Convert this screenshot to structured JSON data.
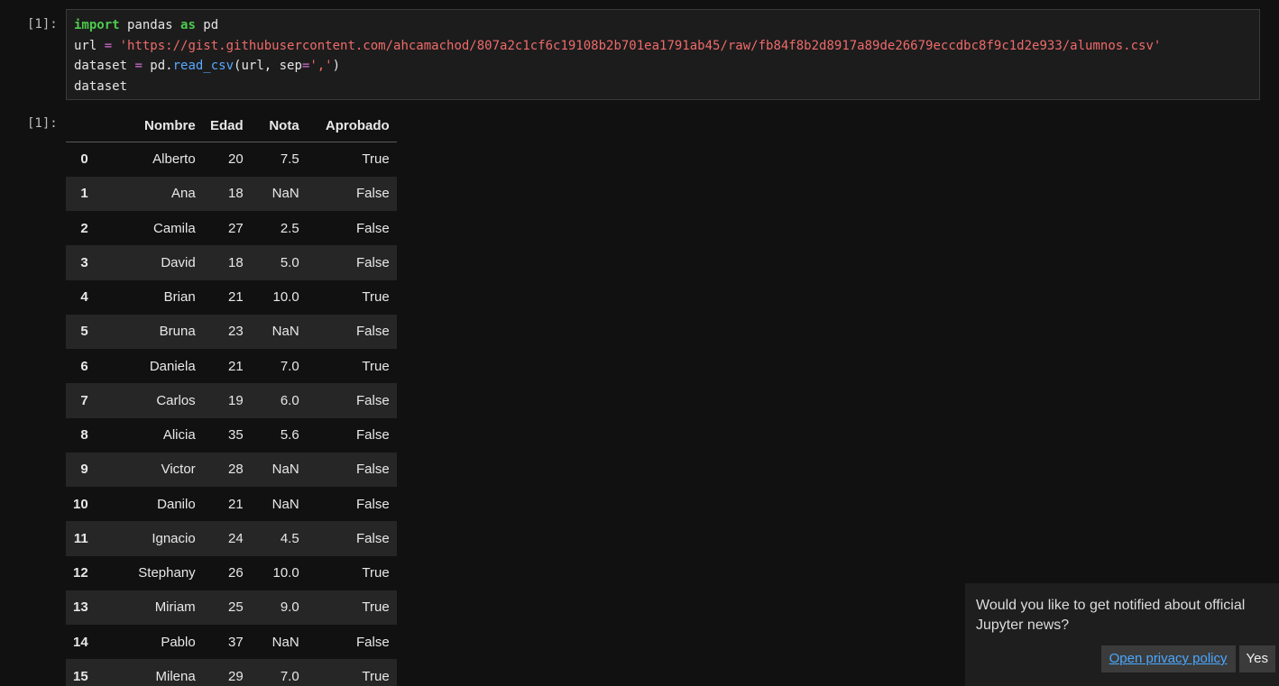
{
  "cells": [
    {
      "prompt": "[1]:",
      "code": {
        "line1": {
          "kw1": "import",
          "mid": " pandas ",
          "kw2": "as",
          "end": " pd"
        },
        "line2": {
          "var": "url ",
          "op": "=",
          "str": " 'https://gist.githubusercontent.com/ahcamachod/807a2c1cf6c19108b2b701ea1791ab45/raw/fb84f8b2d8917a89de26679eccdbc8f9c1d2e933/alumnos.csv'"
        },
        "line3": {
          "var": "dataset ",
          "op": "=",
          "pre": " pd.",
          "fn": "read_csv",
          "args": "(url, sep",
          "op2": "=",
          "str": "','",
          "close": ")"
        },
        "line4": "dataset"
      },
      "output_prompt": "[1]:"
    }
  ],
  "dataframe": {
    "columns": [
      "Nombre",
      "Edad",
      "Nota",
      "Aprobado"
    ],
    "rows": [
      {
        "index": "0",
        "Nombre": "Alberto",
        "Edad": "20",
        "Nota": "7.5",
        "Aprobado": "True"
      },
      {
        "index": "1",
        "Nombre": "Ana",
        "Edad": "18",
        "Nota": "NaN",
        "Aprobado": "False"
      },
      {
        "index": "2",
        "Nombre": "Camila",
        "Edad": "27",
        "Nota": "2.5",
        "Aprobado": "False"
      },
      {
        "index": "3",
        "Nombre": "David",
        "Edad": "18",
        "Nota": "5.0",
        "Aprobado": "False"
      },
      {
        "index": "4",
        "Nombre": "Brian",
        "Edad": "21",
        "Nota": "10.0",
        "Aprobado": "True"
      },
      {
        "index": "5",
        "Nombre": "Bruna",
        "Edad": "23",
        "Nota": "NaN",
        "Aprobado": "False"
      },
      {
        "index": "6",
        "Nombre": "Daniela",
        "Edad": "21",
        "Nota": "7.0",
        "Aprobado": "True"
      },
      {
        "index": "7",
        "Nombre": "Carlos",
        "Edad": "19",
        "Nota": "6.0",
        "Aprobado": "False"
      },
      {
        "index": "8",
        "Nombre": "Alicia",
        "Edad": "35",
        "Nota": "5.6",
        "Aprobado": "False"
      },
      {
        "index": "9",
        "Nombre": "Victor",
        "Edad": "28",
        "Nota": "NaN",
        "Aprobado": "False"
      },
      {
        "index": "10",
        "Nombre": "Danilo",
        "Edad": "21",
        "Nota": "NaN",
        "Aprobado": "False"
      },
      {
        "index": "11",
        "Nombre": "Ignacio",
        "Edad": "24",
        "Nota": "4.5",
        "Aprobado": "False"
      },
      {
        "index": "12",
        "Nombre": "Stephany",
        "Edad": "26",
        "Nota": "10.0",
        "Aprobado": "True"
      },
      {
        "index": "13",
        "Nombre": "Miriam",
        "Edad": "25",
        "Nota": "9.0",
        "Aprobado": "True"
      },
      {
        "index": "14",
        "Nombre": "Pablo",
        "Edad": "37",
        "Nota": "NaN",
        "Aprobado": "False"
      },
      {
        "index": "15",
        "Nombre": "Milena",
        "Edad": "29",
        "Nota": "7.0",
        "Aprobado": "True"
      }
    ]
  },
  "notification": {
    "message": "Would you like to get notified about official Jupyter news?",
    "privacy_label": "Open privacy policy",
    "yes_label": "Yes"
  },
  "colors": {
    "background": "#111111",
    "keyword": "#4ec94e",
    "string": "#f06a6a",
    "function": "#59a8ff",
    "link": "#4aa8ff"
  }
}
